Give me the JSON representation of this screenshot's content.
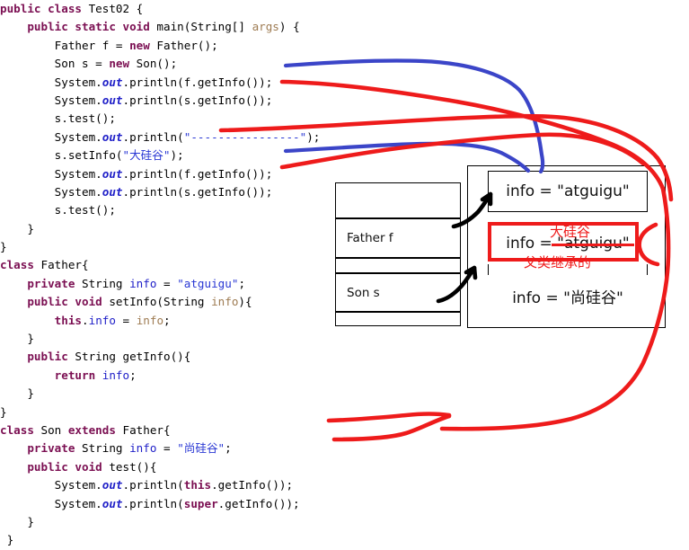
{
  "code": {
    "language": "java",
    "lines": [
      [
        {
          "t": "public ",
          "c": "kw"
        },
        {
          "t": "class ",
          "c": "kw"
        },
        {
          "t": "Test02 {",
          "c": "plain"
        }
      ],
      [
        {
          "t": "    ",
          "c": "plain"
        },
        {
          "t": "public static void ",
          "c": "kw"
        },
        {
          "t": "main(String[] ",
          "c": "plain"
        },
        {
          "t": "args",
          "c": "par"
        },
        {
          "t": ") {",
          "c": "plain"
        }
      ],
      [
        {
          "t": "        Father f = ",
          "c": "plain"
        },
        {
          "t": "new ",
          "c": "kw"
        },
        {
          "t": "Father();",
          "c": "plain"
        }
      ],
      [
        {
          "t": "        Son s = ",
          "c": "plain"
        },
        {
          "t": "new ",
          "c": "kw"
        },
        {
          "t": "Son();",
          "c": "plain"
        }
      ],
      [
        {
          "t": "        System.",
          "c": "plain"
        },
        {
          "t": "out",
          "c": "sfield"
        },
        {
          "t": ".println(f.getInfo());",
          "c": "plain"
        }
      ],
      [
        {
          "t": "        System.",
          "c": "plain"
        },
        {
          "t": "out",
          "c": "sfield"
        },
        {
          "t": ".println(s.getInfo());",
          "c": "plain"
        }
      ],
      [
        {
          "t": "        s.test();",
          "c": "plain"
        }
      ],
      [
        {
          "t": "        System.",
          "c": "plain"
        },
        {
          "t": "out",
          "c": "sfield"
        },
        {
          "t": ".println(",
          "c": "plain"
        },
        {
          "t": "\"----------------\"",
          "c": "str"
        },
        {
          "t": ");",
          "c": "plain"
        }
      ],
      [
        {
          "t": "        s.setInfo(",
          "c": "plain"
        },
        {
          "t": "\"大硅谷\"",
          "c": "str"
        },
        {
          "t": ");",
          "c": "plain"
        }
      ],
      [
        {
          "t": "        System.",
          "c": "plain"
        },
        {
          "t": "out",
          "c": "sfield"
        },
        {
          "t": ".println(f.getInfo());",
          "c": "plain"
        }
      ],
      [
        {
          "t": "        System.",
          "c": "plain"
        },
        {
          "t": "out",
          "c": "sfield"
        },
        {
          "t": ".println(s.getInfo());",
          "c": "plain"
        }
      ],
      [
        {
          "t": "        s.test();",
          "c": "plain"
        }
      ],
      [
        {
          "t": "    }",
          "c": "plain"
        }
      ],
      [
        {
          "t": "}",
          "c": "plain"
        }
      ],
      [
        {
          "t": "class ",
          "c": "kw"
        },
        {
          "t": "Father{",
          "c": "plain"
        }
      ],
      [
        {
          "t": "    ",
          "c": "plain"
        },
        {
          "t": "private ",
          "c": "kw"
        },
        {
          "t": "String ",
          "c": "plain"
        },
        {
          "t": "info",
          "c": "fld"
        },
        {
          "t": " = ",
          "c": "plain"
        },
        {
          "t": "\"atguigu\"",
          "c": "str"
        },
        {
          "t": ";",
          "c": "plain"
        }
      ],
      [
        {
          "t": "    ",
          "c": "plain"
        },
        {
          "t": "public void ",
          "c": "kw"
        },
        {
          "t": "setInfo(String ",
          "c": "plain"
        },
        {
          "t": "info",
          "c": "par"
        },
        {
          "t": "){",
          "c": "plain"
        }
      ],
      [
        {
          "t": "        ",
          "c": "plain"
        },
        {
          "t": "this",
          "c": "kw"
        },
        {
          "t": ".",
          "c": "plain"
        },
        {
          "t": "info",
          "c": "fld"
        },
        {
          "t": " = ",
          "c": "plain"
        },
        {
          "t": "info",
          "c": "par"
        },
        {
          "t": ";",
          "c": "plain"
        }
      ],
      [
        {
          "t": "    }",
          "c": "plain"
        }
      ],
      [
        {
          "t": "    ",
          "c": "plain"
        },
        {
          "t": "public ",
          "c": "kw"
        },
        {
          "t": "String getInfo(){",
          "c": "plain"
        }
      ],
      [
        {
          "t": "        ",
          "c": "plain"
        },
        {
          "t": "return ",
          "c": "kw"
        },
        {
          "t": "info",
          "c": "fld"
        },
        {
          "t": ";",
          "c": "plain"
        }
      ],
      [
        {
          "t": "    }",
          "c": "plain"
        }
      ],
      [
        {
          "t": "}",
          "c": "plain"
        }
      ],
      [
        {
          "t": "class ",
          "c": "kw"
        },
        {
          "t": "Son ",
          "c": "plain"
        },
        {
          "t": "extends ",
          "c": "kw"
        },
        {
          "t": "Father{",
          "c": "plain"
        }
      ],
      [
        {
          "t": "    ",
          "c": "plain"
        },
        {
          "t": "private ",
          "c": "kw"
        },
        {
          "t": "String ",
          "c": "plain"
        },
        {
          "t": "info",
          "c": "fld"
        },
        {
          "t": " = ",
          "c": "plain"
        },
        {
          "t": "\"尚硅谷\"",
          "c": "str"
        },
        {
          "t": ";",
          "c": "plain"
        }
      ],
      [
        {
          "t": "    ",
          "c": "plain"
        },
        {
          "t": "public void ",
          "c": "kw"
        },
        {
          "t": "test(){",
          "c": "plain"
        }
      ],
      [
        {
          "t": "        System.",
          "c": "plain"
        },
        {
          "t": "out",
          "c": "sfield"
        },
        {
          "t": ".println(",
          "c": "plain"
        },
        {
          "t": "this",
          "c": "kw"
        },
        {
          "t": ".getInfo());",
          "c": "plain"
        }
      ],
      [
        {
          "t": "        System.",
          "c": "plain"
        },
        {
          "t": "out",
          "c": "sfield"
        },
        {
          "t": ".println(",
          "c": "plain"
        },
        {
          "t": "super",
          "c": "kw"
        },
        {
          "t": ".getInfo());",
          "c": "plain"
        }
      ],
      [
        {
          "t": "    }",
          "c": "plain"
        }
      ],
      [
        {
          "t": " }",
          "c": "plain"
        }
      ]
    ]
  },
  "diagram": {
    "stack": {
      "rows": [
        {
          "label": "",
          "kind": "empty-tall"
        },
        {
          "label": "Father  f",
          "kind": "var"
        },
        {
          "label": "",
          "kind": "empty-thin"
        },
        {
          "label": "Son  s",
          "kind": "var"
        },
        {
          "label": "",
          "kind": "empty-thin"
        }
      ]
    },
    "heap": {
      "objects": [
        {
          "id": "father-object",
          "text": "info = \"atguigu\""
        },
        {
          "id": "son-inherited-field",
          "text": "info = \"atguigu\"",
          "struck": true
        },
        {
          "id": "son-own-field",
          "text": "info = \"尚硅谷\""
        }
      ]
    },
    "annotations": {
      "new_value": "大硅谷",
      "inherited_note": "父类继承的"
    }
  },
  "colors": {
    "keyword": "#7b0f52",
    "string": "#2a38d4",
    "field": "#2020c8",
    "param": "#9e7b52",
    "annotation_red": "#ee1b1b",
    "ink_blue": "#3b45c8",
    "ink_red": "#ee1b1b",
    "ink_black": "#000000",
    "box_border": "#000000"
  }
}
